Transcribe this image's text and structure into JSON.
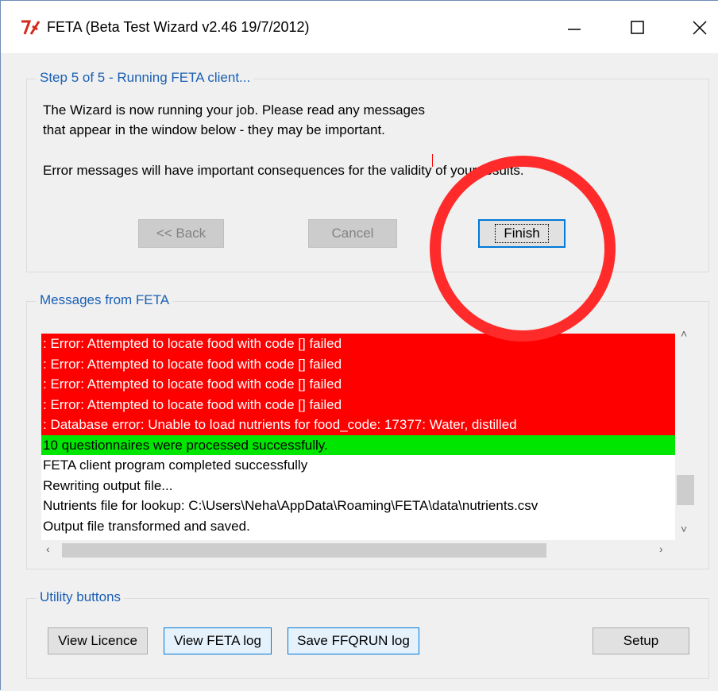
{
  "window": {
    "title": "FETA (Beta Test Wizard v2.46 19/7/2012)",
    "app_icon": "tk-feather-icon"
  },
  "step": {
    "group_title": "Step 5 of 5 - Running FETA client...",
    "paragraph1_line1": "The Wizard is now running your job. Please read any messages",
    "paragraph1_line2": "that appear in the window below - they may be important.",
    "paragraph2": "Error messages will have important consequences for the validity of your results.",
    "back_label": "<< Back",
    "cancel_label": "Cancel",
    "finish_label": "Finish"
  },
  "messages": {
    "group_title": "Messages from FETA",
    "lines": [
      {
        "text": ": Error: Attempted to locate food with code [] failed",
        "type": "error"
      },
      {
        "text": ": Error: Attempted to locate food with code [] failed",
        "type": "error"
      },
      {
        "text": ": Error: Attempted to locate food with code [] failed",
        "type": "error"
      },
      {
        "text": ": Error: Attempted to locate food with code [] failed",
        "type": "error"
      },
      {
        "text": ": Database error: Unable to load nutrients for food_code: 17377: Water, distilled",
        "type": "error"
      },
      {
        "text": "10 questionnaires were processed successfully.",
        "type": "success"
      },
      {
        "text": "FETA client program completed successfully",
        "type": "normal"
      },
      {
        "text": "Rewriting output file...",
        "type": "normal"
      },
      {
        "text": "Nutrients file for lookup: C:\\Users\\Neha\\AppData\\Roaming\\FETA\\data\\nutrients.csv",
        "type": "normal"
      },
      {
        "text": "Output file transformed and saved.",
        "type": "normal"
      }
    ]
  },
  "utility": {
    "group_title": "Utility buttons",
    "view_licence_label": "View Licence",
    "view_feta_log_label": "View FETA log",
    "save_ffqrun_log_label": "Save FFQRUN log",
    "setup_label": "Setup"
  },
  "colors": {
    "error_bg": "#ff0000",
    "success_bg": "#00e600",
    "annotation": "#ff2b2b",
    "group_title": "#1a5fb4"
  }
}
